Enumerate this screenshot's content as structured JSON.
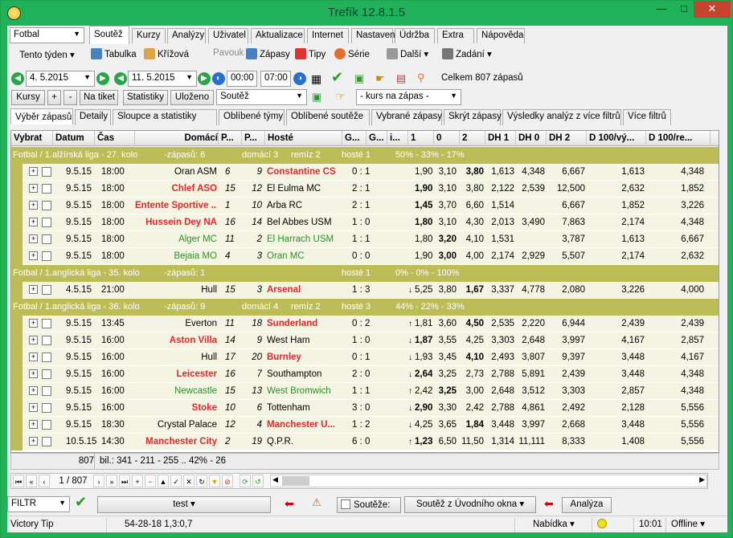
{
  "title": "Trefík 12.8.1.5",
  "window_controls": {
    "min": "—",
    "max": "□",
    "close": "✕"
  },
  "sport": "Fotbal",
  "week": "Tento týden",
  "tabs": [
    "Soutěž",
    "Kurzy",
    "Analýzy",
    "Uživatel",
    "Aktualizace",
    "Internet",
    "Nastavení",
    "Údržba",
    "Extra",
    "Nápověda"
  ],
  "toolbar": {
    "tabulka": "Tabulka",
    "krizova": "Křížová",
    "pavouk": "Pavouk",
    "zapasy": "Zápasy",
    "tipy": "Tipy",
    "serie": "Série",
    "dalsi": "Další",
    "zadani": "Zadání"
  },
  "dates": {
    "from": "4.  5.2015",
    "to": "11.  5.2015",
    "time_from": "00:00",
    "time_to": "07:00",
    "total": "Celkem 807 zápasů"
  },
  "buttons": {
    "kursy": "Kursy",
    "plus": "+",
    "minus": "-",
    "na_tiket": "Na tiket",
    "statistiky": "Statistiky",
    "ulozeno": "Uloženo",
    "soutez_combo": "Soutěž",
    "kurs_combo": "- kurs na zápas -"
  },
  "subtabs": [
    "Výběr zápasů",
    "Detaily",
    "Sloupce a statistiky",
    "Oblíbené týmy",
    "Oblíbené soutěže",
    "Vybrané zápasy",
    "Skrýt zápasy",
    "Výsledky analýz z více filtrů",
    "Více filtrů"
  ],
  "columns": [
    "Vybrat",
    "Datum",
    "Čas",
    "Domácí",
    "P...",
    "P...",
    "Hosté",
    "G...",
    "G...",
    "i...",
    "1",
    "0",
    "2",
    "DH 1",
    "DH 0",
    "DH 2",
    "D 100/vý...",
    "D 100/re..."
  ],
  "groups": [
    {
      "label": "Fotbal / 1.alžírská liga - 27. kolo",
      "zapasu": "-zápasů: 6",
      "domaci": "domácí 3",
      "remiz": "remíz 2",
      "hoste": "hosté 1",
      "pct": "50% - 33% - 17%",
      "rows": [
        {
          "date": "9.5.15",
          "time": "18:00",
          "home": "Oran ASM",
          "hc": "",
          "p1": "6",
          "p2": "9",
          "away": "Constantine CS",
          "ac": "red",
          "score": "0 : 1",
          "i": "",
          "o1": "1,90",
          "o0": "3,10",
          "o2": "3,80",
          "b": "2",
          "dh1": "1,613",
          "dh0": "4,348",
          "dh2": "6,667",
          "d1": "1,613",
          "d2": "4,348"
        },
        {
          "date": "9.5.15",
          "time": "18:00",
          "home": "Chlef ASO",
          "hc": "red",
          "p1": "15",
          "p2": "12",
          "away": "El Eulma MC",
          "ac": "",
          "score": "2 : 1",
          "i": "",
          "o1": "1,90",
          "o0": "3,10",
          "o2": "3,80",
          "b": "1",
          "dh1": "2,122",
          "dh0": "2,539",
          "dh2": "12,500",
          "d1": "2,632",
          "d2": "1,852"
        },
        {
          "date": "9.5.15",
          "time": "18:00",
          "home": "Entente Sportive ...",
          "hc": "red",
          "p1": "1",
          "p2": "10",
          "away": "Arba RC",
          "ac": "",
          "score": "2 : 1",
          "i": "",
          "o1": "1,45",
          "o0": "3,70",
          "o2": "6,60",
          "b": "1",
          "dh1": "1,514",
          "dh0": "",
          "dh2": "6,667",
          "d1": "1,852",
          "d2": "3,226"
        },
        {
          "date": "9.5.15",
          "time": "18:00",
          "home": "Hussein Dey NA",
          "hc": "red",
          "p1": "16",
          "p2": "14",
          "away": "Bel Abbes USM",
          "ac": "",
          "score": "1 : 0",
          "i": "",
          "o1": "1,80",
          "o0": "3,10",
          "o2": "4,30",
          "b": "1",
          "dh1": "2,013",
          "dh0": "3,490",
          "dh2": "7,863",
          "d1": "2,174",
          "d2": "4,348"
        },
        {
          "date": "9.5.15",
          "time": "18:00",
          "home": "Alger MC",
          "hc": "grn",
          "p1": "11",
          "p2": "2",
          "away": "El Harrach USM",
          "ac": "grn",
          "score": "1 : 1",
          "i": "",
          "o1": "1,80",
          "o0": "3,20",
          "o2": "4,10",
          "b": "0",
          "dh1": "1,531",
          "dh0": "",
          "dh2": "3,787",
          "d1": "1,613",
          "d2": "6,667"
        },
        {
          "date": "9.5.15",
          "time": "18:00",
          "home": "Bejaia MO",
          "hc": "grn",
          "p1": "4",
          "p2": "3",
          "away": "Oran MC",
          "ac": "grn",
          "score": "0 : 0",
          "i": "",
          "o1": "1,90",
          "o0": "3,00",
          "o2": "4,00",
          "b": "0",
          "dh1": "2,174",
          "dh0": "2,929",
          "dh2": "5,507",
          "d1": "2,174",
          "d2": "2,632"
        }
      ]
    },
    {
      "label": "Fotbal / 1.anglická liga - 35. kolo",
      "zapasu": "-zápasů: 1",
      "domaci": "",
      "remiz": "",
      "hoste": "hosté 1",
      "pct": "0% - 0% - 100%",
      "rows": [
        {
          "date": "4.5.15",
          "time": "21:00",
          "home": "Hull",
          "hc": "",
          "p1": "15",
          "p2": "3",
          "away": "Arsenal",
          "ac": "red",
          "score": "1 : 3",
          "i": "↓",
          "o1": "5,25",
          "o0": "3,80",
          "o2": "1,67",
          "b": "2",
          "dh1": "3,337",
          "dh0": "4,778",
          "dh2": "2,080",
          "d1": "3,226",
          "d2": "4,000"
        }
      ]
    },
    {
      "label": "Fotbal / 1.anglická liga - 36. kolo",
      "zapasu": "-zápasů: 9",
      "domaci": "domácí 4",
      "remiz": "remíz 2",
      "hoste": "hosté 3",
      "pct": "44% - 22% - 33%",
      "rows": [
        {
          "date": "9.5.15",
          "time": "13:45",
          "home": "Everton",
          "hc": "",
          "p1": "11",
          "p2": "18",
          "away": "Sunderland",
          "ac": "red",
          "score": "0 : 2",
          "i": "↑",
          "o1": "1,81",
          "o0": "3,60",
          "o2": "4,50",
          "b": "2",
          "dh1": "2,535",
          "dh0": "2,220",
          "dh2": "6,944",
          "d1": "2,439",
          "d2": "2,439"
        },
        {
          "date": "9.5.15",
          "time": "16:00",
          "home": "Aston Villa",
          "hc": "red",
          "p1": "14",
          "p2": "9",
          "away": "West Ham",
          "ac": "",
          "score": "1 : 0",
          "i": "↓",
          "o1": "1,87",
          "o0": "3,55",
          "o2": "4,25",
          "b": "1",
          "dh1": "3,303",
          "dh0": "2,648",
          "dh2": "3,997",
          "d1": "4,167",
          "d2": "2,857"
        },
        {
          "date": "9.5.15",
          "time": "16:00",
          "home": "Hull",
          "hc": "",
          "p1": "17",
          "p2": "20",
          "away": "Burnley",
          "ac": "red",
          "score": "0 : 1",
          "i": "↓",
          "o1": "1,93",
          "o0": "3,45",
          "o2": "4,10",
          "b": "2",
          "dh1": "2,493",
          "dh0": "3,807",
          "dh2": "9,397",
          "d1": "3,448",
          "d2": "4,167"
        },
        {
          "date": "9.5.15",
          "time": "16:00",
          "home": "Leicester",
          "hc": "red",
          "p1": "16",
          "p2": "7",
          "away": "Southampton",
          "ac": "",
          "score": "2 : 0",
          "i": "↓",
          "o1": "2,64",
          "o0": "3,25",
          "o2": "2,73",
          "b": "1",
          "dh1": "2,788",
          "dh0": "5,891",
          "dh2": "2,439",
          "d1": "3,448",
          "d2": "4,348"
        },
        {
          "date": "9.5.15",
          "time": "16:00",
          "home": "Newcastle",
          "hc": "grn",
          "p1": "15",
          "p2": "13",
          "away": "West Bromwich",
          "ac": "grn",
          "score": "1 : 1",
          "i": "↑",
          "o1": "2,42",
          "o0": "3,25",
          "o2": "3,00",
          "b": "0",
          "dh1": "2,648",
          "dh0": "3,512",
          "dh2": "3,303",
          "d1": "2,857",
          "d2": "4,348"
        },
        {
          "date": "9.5.15",
          "time": "16:00",
          "home": "Stoke",
          "hc": "red",
          "p1": "10",
          "p2": "6",
          "away": "Tottenham",
          "ac": "",
          "score": "3 : 0",
          "i": "↓",
          "o1": "2,90",
          "o0": "3,30",
          "o2": "2,42",
          "b": "1",
          "dh1": "2,788",
          "dh0": "4,861",
          "dh2": "2,492",
          "d1": "2,128",
          "d2": "5,556"
        },
        {
          "date": "9.5.15",
          "time": "18:30",
          "home": "Crystal Palace",
          "hc": "",
          "p1": "12",
          "p2": "4",
          "away": "Manchester U...",
          "ac": "red",
          "score": "1 : 2",
          "i": "↓",
          "o1": "4,25",
          "o0": "3,65",
          "o2": "1,84",
          "b": "2",
          "dh1": "3,448",
          "dh0": "3,997",
          "dh2": "2,668",
          "d1": "3,448",
          "d2": "5,556"
        },
        {
          "date": "10.5.15",
          "time": "14:30",
          "home": "Manchester City",
          "hc": "red",
          "p1": "2",
          "p2": "19",
          "away": "Q.P.R.",
          "ac": "",
          "score": "6 : 0",
          "i": "↑",
          "o1": "1,23",
          "o0": "6,50",
          "o2": "11,50",
          "b": "1",
          "dh1": "1,314",
          "dh0": "11,111",
          "dh2": "8,333",
          "d1": "1,408",
          "d2": "5,556"
        }
      ]
    }
  ],
  "summary": {
    "count": "807",
    "bil": "bil.: 341 - 211 - 255 .. 42% - 26"
  },
  "nav": {
    "page": "1 / 807"
  },
  "filter": {
    "label": "FILTR",
    "test": "test",
    "soutezy": "Soutěže:",
    "uvod": "Soutěž z Úvodního okna",
    "analyza": "Analýza"
  },
  "status": {
    "app": "Victory Tip",
    "code": "54-28-18  1,3:0,7",
    "nabidka": "Nabídka",
    "time": "10:01",
    "offline": "Offline"
  },
  "colors": {
    "accent": "#1fb25a",
    "group": "#bdbd58",
    "row": "#f4f4e2",
    "red": "#e4262c",
    "green": "#2f8f2f"
  }
}
